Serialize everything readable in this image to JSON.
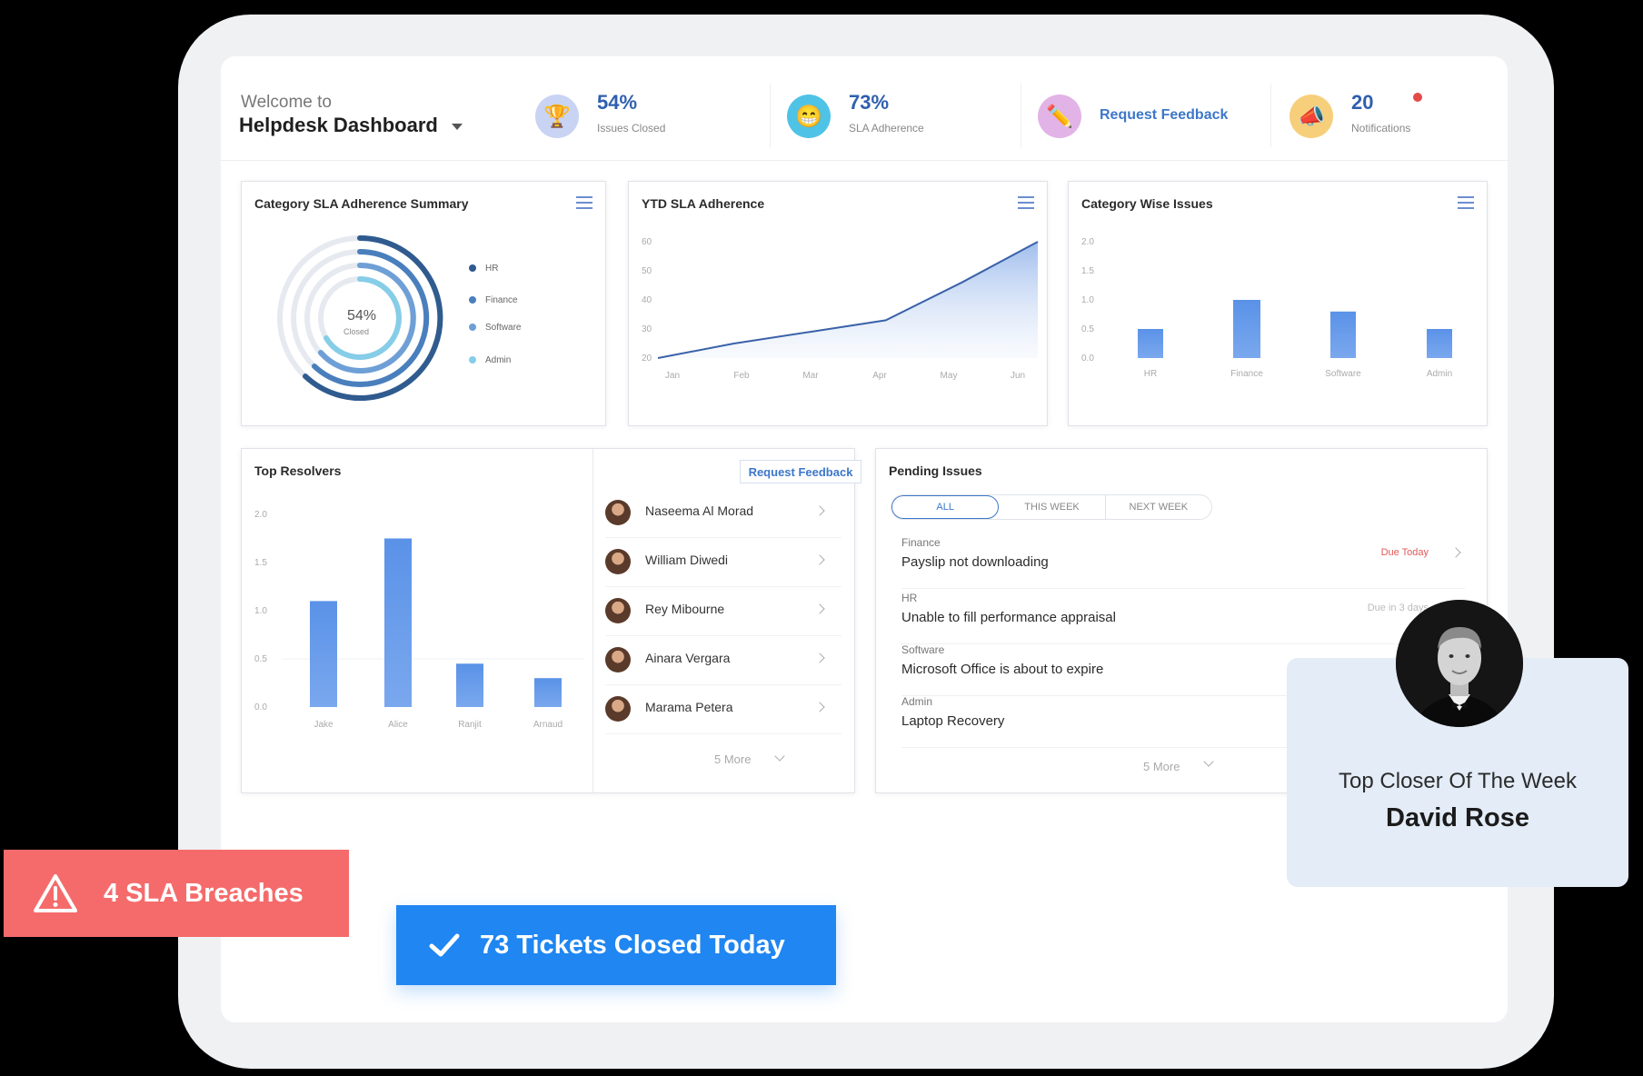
{
  "header": {
    "welcome": "Welcome to",
    "title": "Helpdesk Dashboard",
    "stats": [
      {
        "value": "54%",
        "label": "Issues Closed",
        "icon": "trophy-icon"
      },
      {
        "value": "73%",
        "label": "SLA Adherence",
        "icon": "smiley-icon"
      },
      {
        "link": "Request Feedback",
        "icon": "pencil-icon"
      },
      {
        "value": "20",
        "label": "Notifications",
        "icon": "megaphone-icon"
      }
    ]
  },
  "cards": {
    "sla_summary": {
      "title": "Category SLA Adherence Summary",
      "center_value": "54%",
      "center_label": "Closed",
      "legend": [
        {
          "label": "HR",
          "color": "#2f5b8f"
        },
        {
          "label": "Finance",
          "color": "#4a7fbd"
        },
        {
          "label": "Software",
          "color": "#6e9fd6"
        },
        {
          "label": "Admin",
          "color": "#86cde8"
        }
      ]
    },
    "ytd": {
      "title": "YTD SLA Adherence"
    },
    "category_wise": {
      "title": "Category Wise Issues"
    },
    "top_resolvers": {
      "title": "Top Resolvers",
      "request_feedback": "Request Feedback",
      "people": [
        {
          "name": "Naseema Al Morad"
        },
        {
          "name": "William Diwedi"
        },
        {
          "name": "Rey Mibourne"
        },
        {
          "name": "Ainara Vergara"
        },
        {
          "name": "Marama Petera"
        }
      ],
      "more": "5 More"
    },
    "pending": {
      "title": "Pending Issues",
      "tabs": [
        "ALL",
        "THIS WEEK",
        "NEXT WEEK"
      ],
      "issues": [
        {
          "category": "Finance",
          "title": "Payslip not downloading",
          "due": "Due Today"
        },
        {
          "category": "HR",
          "title": "Unable to fill performance appraisal",
          "due": "Due in 3 days"
        },
        {
          "category": "Software",
          "title": "Microsoft Office is about to expire",
          "due": ""
        },
        {
          "category": "Admin",
          "title": "Laptop Recovery",
          "due": ""
        }
      ],
      "more": "5 More"
    }
  },
  "overlays": {
    "sla_breaches": "4 SLA Breaches",
    "tickets_closed": "73 Tickets Closed Today",
    "closer_label": "Top Closer Of The Week",
    "closer_name": "David Rose"
  },
  "chart_data": [
    {
      "type": "pie",
      "title": "Category SLA Adherence Summary",
      "categories": [
        "HR",
        "Finance",
        "Software",
        "Admin"
      ],
      "center_text": "54% Closed"
    },
    {
      "type": "area",
      "title": "YTD SLA Adherence",
      "categories": [
        "Jan",
        "Feb",
        "Mar",
        "Apr",
        "May",
        "Jun"
      ],
      "values": [
        20,
        25,
        29,
        33,
        46,
        60
      ],
      "yticks": [
        60,
        50,
        40,
        30,
        20
      ],
      "ylim": [
        20,
        60
      ]
    },
    {
      "type": "bar",
      "title": "Category Wise Issues",
      "categories": [
        "HR",
        "Finance",
        "Software",
        "Admin"
      ],
      "values": [
        0.5,
        1.0,
        0.8,
        0.5
      ],
      "yticks": [
        "2.0",
        "1.5",
        "1.0",
        "0.5",
        "0.0"
      ],
      "ylim": [
        0,
        2.0
      ]
    },
    {
      "type": "bar",
      "title": "Top Resolvers",
      "categories": [
        "Jake",
        "Alice",
        "Ranjit",
        "Arnaud"
      ],
      "values": [
        1.1,
        1.75,
        0.45,
        0.3
      ],
      "yticks": [
        "2.0",
        "1.5",
        "1.0",
        "0.5",
        "0.0"
      ],
      "ylim": [
        0,
        2.0
      ]
    }
  ]
}
